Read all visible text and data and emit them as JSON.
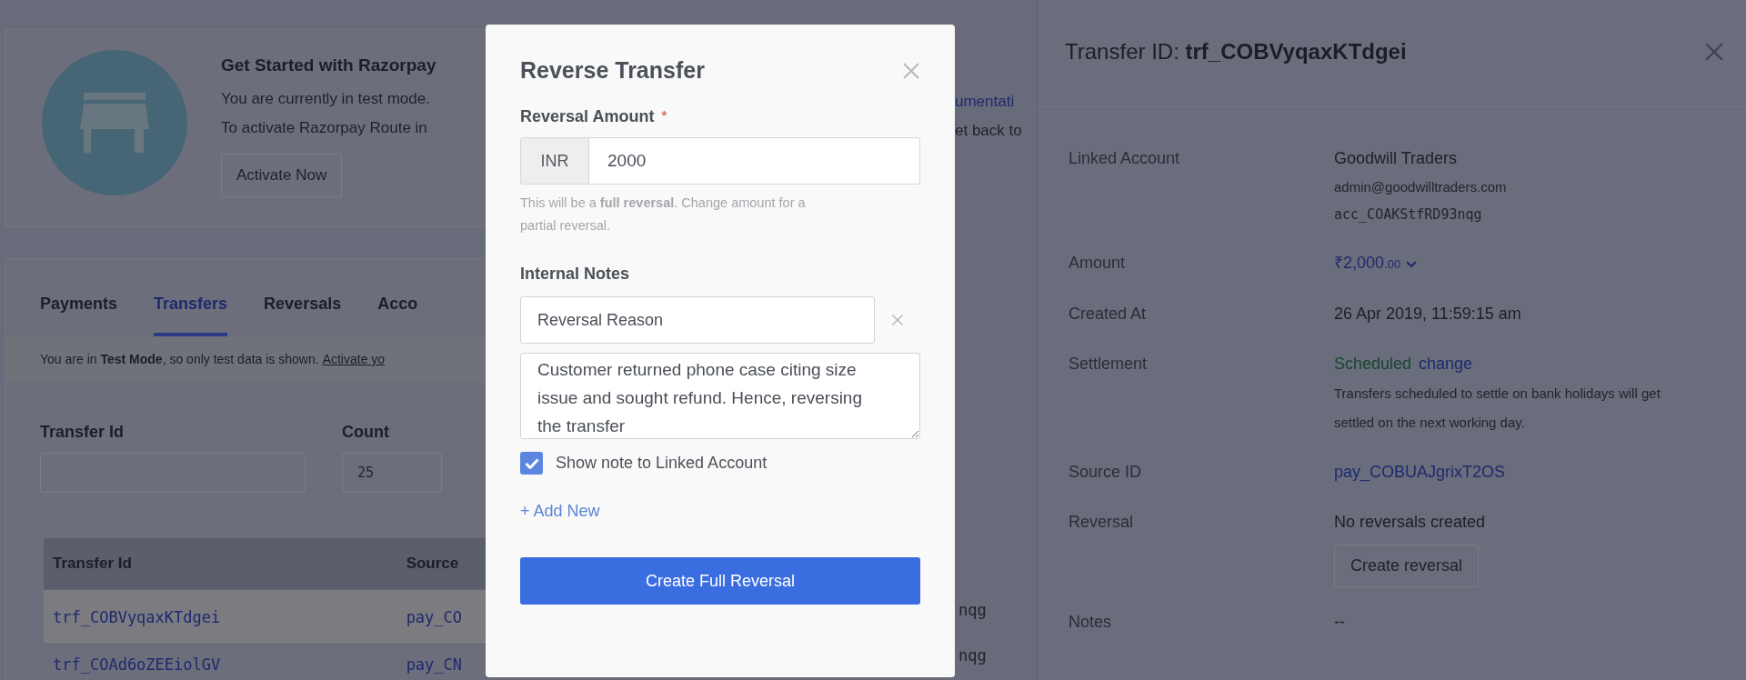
{
  "banner": {
    "title": "Get Started with Razorpay",
    "lines": [
      "You are currently in test mode.",
      "To activate Razorpay Route in"
    ],
    "button": "Activate Now"
  },
  "tabs": [
    {
      "label": "Payments",
      "selected": false
    },
    {
      "label": "Transfers",
      "selected": true
    },
    {
      "label": "Reversals",
      "selected": false
    },
    {
      "label": "Acco",
      "selected": false
    }
  ],
  "test_mode_notice": {
    "text": "You are in **Test Mode**, so only test data is shown.",
    "link": "Activate yo"
  },
  "filters": [
    {
      "label": "Transfer Id"
    },
    {
      "label": "Count",
      "value": "25"
    }
  ],
  "table": {
    "columns": [
      "Transfer Id",
      "Source"
    ],
    "rows": [
      {
        "cells": [
          "trf_COBVyqaxKTdgei",
          "pay_CO"
        ],
        "selected": true
      },
      {
        "cells": [
          "trf_COAd6oZEEiolGV",
          "pay_CN"
        ],
        "selected": false
      }
    ]
  },
  "strip": {
    "banner_link": "umentati",
    "banner_line": "et back to",
    "row_cells": [
      "nqg",
      "nqg"
    ]
  },
  "modal": {
    "title": "Reverse Transfer",
    "amount": {
      "label": "Reversal Amount",
      "required_mark": "*",
      "currency": "INR",
      "value": "2000",
      "help": "This will be a **full reversal**. Change amount for a partial reversal."
    },
    "notes": {
      "label": "Internal Notes",
      "entries": [
        {
          "key": "Reversal Reason",
          "value": "Customer returned phone case citing size issue and sought refund. Hence, reversing the transfer"
        }
      ]
    },
    "show_note": {
      "label": "Show note to Linked Account",
      "checked": true
    },
    "add_link": "+ Add New",
    "submit": "Create Full Reversal"
  },
  "detail": {
    "title": "Transfer ID: **trf_COBVyqaxKTdgei**",
    "rows": [
      {
        "label": "Linked Account",
        "kind": "account",
        "name": "Goodwill Traders",
        "email": "admin@goodwilltraders.com",
        "account_id": "acc_COAKStfRD93nqg"
      },
      {
        "label": "Amount",
        "kind": "amount",
        "major": "₹2,000",
        "minor": ".00"
      },
      {
        "label": "Created At",
        "kind": "text",
        "value": "26 Apr 2019, 11:59:15 am"
      },
      {
        "label": "Settlement",
        "kind": "settlement",
        "status": "Scheduled",
        "action": "change",
        "note": "Transfers scheduled to settle on bank holidays will get settled on the next working day."
      },
      {
        "label": "Source ID",
        "kind": "link",
        "value": "pay_COBUAJgrixT2OS"
      },
      {
        "label": "Reversal",
        "kind": "reversal",
        "value": "No reversals created",
        "button": "Create reversal"
      },
      {
        "label": "Notes",
        "kind": "text",
        "value": "--"
      }
    ]
  }
}
